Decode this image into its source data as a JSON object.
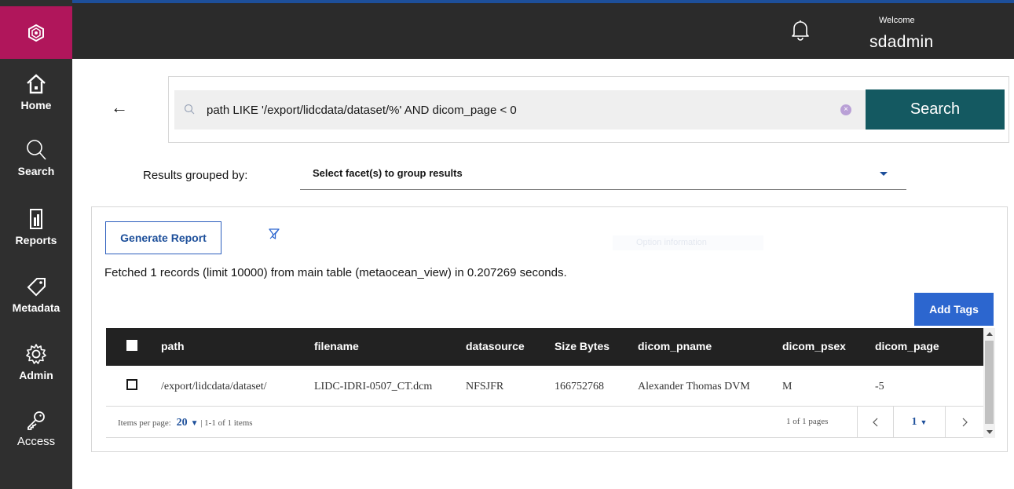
{
  "sidebar": {
    "logo_icon": "hexagon-logo-icon",
    "items": [
      {
        "label": "Home",
        "icon": "home-icon"
      },
      {
        "label": "Search",
        "icon": "search-icon"
      },
      {
        "label": "Reports",
        "icon": "reports-icon"
      },
      {
        "label": "Metadata",
        "icon": "tag-icon"
      },
      {
        "label": "Admin",
        "icon": "gear-icon"
      },
      {
        "label": "Access",
        "icon": "key-icon"
      }
    ]
  },
  "header": {
    "welcome": "Welcome",
    "username": "sdadmin",
    "notification_icon": "bell-icon"
  },
  "search": {
    "query": "path LIKE '/export/lidcdata/dataset/%' AND dicom_page < 0",
    "button_label": "Search"
  },
  "grouping": {
    "label": "Results grouped by:",
    "placeholder": "Select facet(s) to group results"
  },
  "results": {
    "generate_report_label": "Generate Report",
    "ghost_control": "Option information",
    "fetched_text": "Fetched 1 records (limit 10000) from main table (metaocean_view) in 0.207269 seconds.",
    "add_tags_label": "Add Tags",
    "columns": [
      "path",
      "filename",
      "datasource",
      "Size Bytes",
      "dicom_pname",
      "dicom_psex",
      "dicom_page"
    ],
    "rows": [
      [
        "/export/lidcdata/dataset/",
        "LIDC-IDRI-0507_CT.dcm",
        "NFSJFR",
        "166752768",
        "Alexander Thomas DVM",
        "M",
        "-5"
      ]
    ],
    "pagination": {
      "items_per_page_label": "Items per page:",
      "items_per_page_value": "20",
      "range_text": "| 1-1 of 1 items",
      "page_count_text": "1 of 1 pages",
      "current_page": "1"
    }
  },
  "colors": {
    "sidebar_bg": "#2f2f2f",
    "logo_bg": "#b0165b",
    "search_button": "#145961",
    "primary_blue": "#2c66cf",
    "topbar": "#2b2b2b"
  }
}
